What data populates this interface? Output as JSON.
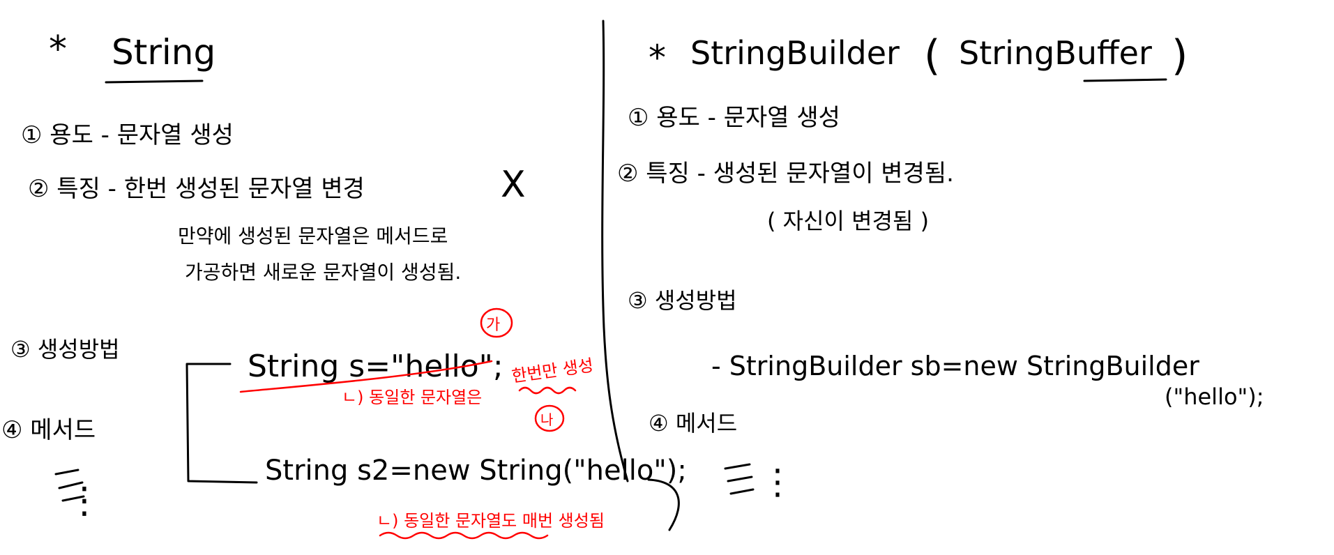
{
  "string_section": {
    "star": "*",
    "title": "String",
    "p1": "① 용도 - 문자열 생성",
    "p2": "② 특징 - 한번 생성된 문자열 변경",
    "p2_mark": "X",
    "p2_note_1": "만약에 생성된 문자열은 메서드로",
    "p2_note_2": "가공하면 새로운 문자열이 생성됨.",
    "p3": "③ 생성방법",
    "code1": "String s=\"hello\";",
    "tag_ga": "가",
    "red_note1_a": "ㄴ) 동일한 문자열은",
    "red_note1_b": "한번만 생성",
    "code2": "String s2=new String(\"hello\");",
    "tag_na": "나",
    "red_note2": "ㄴ) 동일한 문자열도 매번 생성됨",
    "p4": "④ 메서드",
    "ellipsis": "⋮"
  },
  "builder_section": {
    "star": "*",
    "title": "StringBuilder",
    "paren_open": "(",
    "title2": "StringBuffer",
    "paren_close": ")",
    "p1": "① 용도 - 문자열 생성",
    "p2": "② 특징 - 생성된 문자열이 변경됨.",
    "p2_note": "( 자신이 변경됨 )",
    "p3": "③ 생성방법",
    "code1": "- StringBuilder sb=new StringBuilder",
    "code1_cont": "(\"hello\");",
    "p4": "④ 메서드",
    "ellipsis": "⋮"
  },
  "colors": {
    "ink": "#000000",
    "red_ink": "#ff0000",
    "background": "#ffffff"
  }
}
